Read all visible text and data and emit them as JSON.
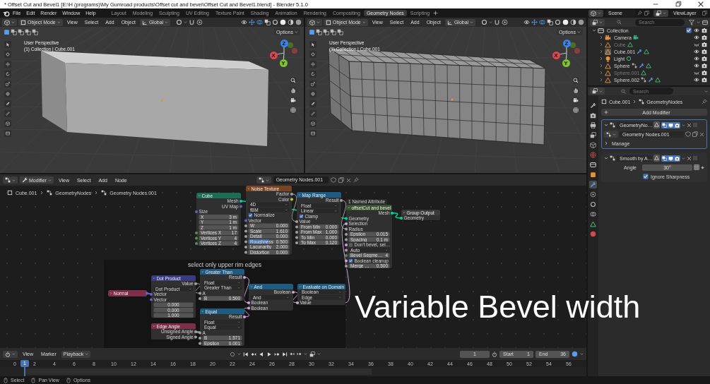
{
  "window": {
    "title": "* Offset Cut and Bevel1 [E:\\H (programs)\\My Gumroad products\\Offset cut and bevel\\Offset Cut and Bevel1.blend] - Blender 5.1.0"
  },
  "menus": [
    "File",
    "Edit",
    "Render",
    "Window",
    "Help"
  ],
  "workspaces": [
    {
      "label": "Layout",
      "selected": false
    },
    {
      "label": "Modeling",
      "selected": false
    },
    {
      "label": "Sculpting",
      "selected": false
    },
    {
      "label": "UV Editing",
      "selected": false
    },
    {
      "label": "Texture Paint",
      "selected": false
    },
    {
      "label": "Shading",
      "selected": false
    },
    {
      "label": "Animation",
      "selected": false
    },
    {
      "label": "Rendering",
      "selected": false
    },
    {
      "label": "Compositing",
      "selected": false
    },
    {
      "label": "Geometry Nodes",
      "selected": true
    },
    {
      "label": "Scripting",
      "selected": false
    }
  ],
  "scene": "Scene",
  "view_layer": "ViewLayer",
  "viewports": [
    {
      "mode": "Object Mode",
      "menus": [
        "View",
        "Select",
        "Add",
        "Object"
      ],
      "orientation": "Global",
      "options": "Options",
      "perspective": "User Perspective",
      "context": "(1) Collection | Cube.001",
      "axes": [
        "X",
        "Y",
        "Z"
      ],
      "kind": "solid"
    },
    {
      "mode": "Object Mode",
      "menus": [
        "View",
        "Select",
        "Add",
        "Object"
      ],
      "orientation": "Global",
      "options": "Options",
      "perspective": "User Perspective",
      "context": "(1) Collection | Cube.001",
      "axes": [
        "X",
        "Y",
        "Z"
      ],
      "kind": "wireframe"
    }
  ],
  "outliner": {
    "search_placeholder": "Search",
    "tree": [
      {
        "label": "Collection",
        "kind": "collection",
        "expanded": true,
        "checked": true,
        "children": [
          {
            "label": "Camera",
            "kind": "camera",
            "has_geometry_nodes": false,
            "has_modifiers": false,
            "hidden": false,
            "selected": false
          },
          {
            "label": "Cube",
            "kind": "mesh",
            "has_geometry_nodes": false,
            "has_modifiers": false,
            "hidden": true,
            "selected": false
          },
          {
            "label": "Cube.001",
            "kind": "mesh",
            "has_geometry_nodes": false,
            "has_modifiers": true,
            "hidden": false,
            "selected": true
          },
          {
            "label": "Light",
            "kind": "light",
            "has_geometry_nodes": false,
            "has_modifiers": false,
            "hidden": false,
            "selected": false
          },
          {
            "label": "Sphere",
            "kind": "mesh",
            "has_geometry_nodes": true,
            "has_modifiers": true,
            "hidden": false,
            "selected": false
          },
          {
            "label": "Sphere.001",
            "kind": "mesh",
            "has_geometry_nodes": false,
            "has_modifiers": false,
            "hidden": true,
            "selected": false
          },
          {
            "label": "Sphere.002",
            "kind": "mesh",
            "has_geometry_nodes": true,
            "has_modifiers": true,
            "hidden": false,
            "selected": false
          }
        ]
      }
    ]
  },
  "properties": {
    "search_placeholder": "Search",
    "tabs": [
      {
        "kind": "tool",
        "selected": false
      },
      {
        "kind": "render",
        "selected": false
      },
      {
        "kind": "output",
        "selected": false
      },
      {
        "kind": "view_layer",
        "selected": false
      },
      {
        "kind": "scene",
        "selected": false
      },
      {
        "kind": "world",
        "selected": false
      },
      {
        "kind": "collection",
        "selected": false
      },
      {
        "kind": "object",
        "selected": false
      },
      {
        "kind": "modifiers",
        "selected": true
      },
      {
        "kind": "particles",
        "selected": false
      },
      {
        "kind": "physics",
        "selected": false
      },
      {
        "kind": "constraints",
        "selected": false
      },
      {
        "kind": "data",
        "selected": false
      },
      {
        "kind": "material",
        "selected": false
      }
    ],
    "breadcrumb": [
      "Cube.001",
      "GeometryNodes"
    ],
    "add_modifier": "Add Modifier",
    "modifiers": [
      {
        "kind": "nodes",
        "name": "GeometryNo…",
        "expanded": true,
        "active": true,
        "node_group": "Geometry Nodes.001",
        "section": "Manage",
        "section_expanded": false
      },
      {
        "kind": "smooth",
        "name": "Smooth by A…",
        "expanded": true,
        "active": false,
        "field_label": "Angle",
        "field_value": "30°",
        "option": "Ignore Sharpness",
        "option_checked": true
      }
    ]
  },
  "node_editor": {
    "context": "Modifier",
    "menus": [
      "View",
      "Select",
      "Add",
      "Node"
    ],
    "node_group": "Geometry Nodes.001",
    "breadcrumb": [
      "Cube.001",
      "GeometryNodes",
      "Geometry Nodes.001"
    ],
    "frame_label": "select only upper rim edges",
    "nodes": [
      {
        "title": "Cube",
        "color": "#1e6b56",
        "collapsed": false,
        "rows": [
          {
            "kind": "out",
            "label": "Mesh",
            "color": "#00d6a3"
          },
          {
            "kind": "out",
            "label": "UV Map",
            "color": "#6363c7"
          },
          {
            "kind": "in",
            "label": "Size",
            "color": "#6363c7"
          },
          {
            "kind": "value",
            "label": "X",
            "value": "3 m"
          },
          {
            "kind": "value",
            "label": "Y",
            "value": "1 m"
          },
          {
            "kind": "value",
            "label": "Z",
            "value": "1 m"
          },
          {
            "kind": "value",
            "label": "Vertices X",
            "value": "17",
            "color": "#598c5c"
          },
          {
            "kind": "value",
            "label": "Vertices Y",
            "value": "4",
            "color": "#598c5c"
          },
          {
            "kind": "value",
            "label": "Vertices Z",
            "value": "4",
            "color": "#598c5c"
          }
        ]
      },
      {
        "title": "Noise Texture",
        "color": "#7a4322",
        "collapsed": false,
        "rows": [
          {
            "kind": "out",
            "label": "Factor",
            "color": "#a1a1a1"
          },
          {
            "kind": "out",
            "label": "Color",
            "color": "#c7c729"
          },
          {
            "kind": "menu",
            "value": "4D"
          },
          {
            "kind": "menu",
            "value": "fBM"
          },
          {
            "kind": "check",
            "label": "Normalize",
            "checked": true
          },
          {
            "kind": "in",
            "label": "Vector",
            "color": "#6363c7"
          },
          {
            "kind": "value",
            "label": "W",
            "value": "0.000",
            "color": "#a1a1a1"
          },
          {
            "kind": "value",
            "label": "Scale",
            "value": "1.610",
            "color": "#a1a1a1"
          },
          {
            "kind": "value",
            "label": "Detail",
            "value": "0.000",
            "color": "#a1a1a1"
          },
          {
            "kind": "slider",
            "label": "Roughness",
            "value": "0.500",
            "level": 0.5,
            "color": "#a1a1a1"
          },
          {
            "kind": "value",
            "label": "Lacunarity",
            "value": "2.000",
            "color": "#a1a1a1"
          },
          {
            "kind": "value",
            "label": "Distortion",
            "value": "0.000",
            "color": "#a1a1a1"
          }
        ]
      },
      {
        "title": "Map Range",
        "color": "#1f5a80",
        "collapsed": false,
        "rows": [
          {
            "kind": "out",
            "label": "Result",
            "color": "#a1a1a1"
          },
          {
            "kind": "menu",
            "value": "Float"
          },
          {
            "kind": "menu",
            "value": "Linear"
          },
          {
            "kind": "check",
            "label": "Clamp",
            "checked": true
          },
          {
            "kind": "in",
            "label": "Value",
            "color": "#a1a1a1"
          },
          {
            "kind": "value",
            "label": "From Min",
            "value": "0.000",
            "color": "#a1a1a1"
          },
          {
            "kind": "value",
            "label": "From Max",
            "value": "1.000",
            "color": "#a1a1a1"
          },
          {
            "kind": "value",
            "label": "To Min",
            "value": "0.000",
            "color": "#a1a1a1"
          },
          {
            "kind": "value",
            "label": "To Max",
            "value": "0.120",
            "color": "#a1a1a1"
          }
        ]
      },
      {
        "title": "offsetCut and bevel",
        "color": "#3b5230",
        "collapsed": false,
        "badge": "1 Named Attribute",
        "rows": [
          {
            "kind": "out",
            "label": "Mesh",
            "color": "#00d6a3"
          },
          {
            "kind": "in",
            "label": "Geometry",
            "color": "#00d6a3"
          },
          {
            "kind": "in",
            "label": "Selection",
            "color": "#cca6d6"
          },
          {
            "kind": "in",
            "label": "Radius",
            "color": "#a1a1a1"
          },
          {
            "kind": "value",
            "label": "Epsilon",
            "value": "0.015",
            "color": "#a1a1a1"
          },
          {
            "kind": "value",
            "label": "Spacing",
            "value": "0.1 m",
            "color": "#a1a1a1"
          },
          {
            "kind": "check",
            "label": "Don't bevel, sel…",
            "checked": false,
            "color": "#cca6d6"
          },
          {
            "kind": "menu",
            "value": "Auto",
            "color": "#a1a1a1"
          },
          {
            "kind": "value",
            "label": "Bevel Segme…",
            "value": "4",
            "color": "#598c5c"
          },
          {
            "kind": "check",
            "label": "Boolean cleanup",
            "checked": true,
            "color": "#cca6d6"
          },
          {
            "kind": "value",
            "label": "Merge …",
            "value": "0.500",
            "color": "#a1a1a1"
          }
        ]
      },
      {
        "title": "Group Output",
        "color": "#3a3a3a",
        "collapsed": false,
        "rows": [
          {
            "kind": "in",
            "label": "Geometry",
            "color": "#00d6a3"
          }
        ]
      },
      {
        "title": "Normal",
        "color": "#7d2e48",
        "collapsed": true,
        "rows": [
          {
            "kind": "out",
            "color": "#6363c7"
          }
        ]
      },
      {
        "title": "Dot Product",
        "color": "#3a3a80",
        "collapsed": false,
        "rows": [
          {
            "kind": "out",
            "label": "Value",
            "color": "#a1a1a1"
          },
          {
            "kind": "menu",
            "value": "Dot Product"
          },
          {
            "kind": "in",
            "label": "Vector",
            "color": "#6363c7"
          },
          {
            "kind": "in",
            "label": "Vector",
            "color": "#6363c7"
          },
          {
            "kind": "value",
            "value": "0.000"
          },
          {
            "kind": "value",
            "value": "0.000"
          },
          {
            "kind": "value",
            "value": "1.000"
          }
        ]
      },
      {
        "title": "Edge Angle",
        "color": "#7d2e48",
        "collapsed": false,
        "rows": [
          {
            "kind": "out",
            "label": "Unsigned Angle",
            "color": "#a1a1a1"
          },
          {
            "kind": "out",
            "label": "Signed Angle",
            "color": "#a1a1a1"
          }
        ]
      },
      {
        "title": "Greater Than",
        "color": "#1f5a80",
        "collapsed": false,
        "rows": [
          {
            "kind": "out",
            "label": "Result",
            "color": "#cca6d6"
          },
          {
            "kind": "menu",
            "value": "Float"
          },
          {
            "kind": "menu",
            "value": "Greater Than"
          },
          {
            "kind": "in",
            "label": "A",
            "color": "#a1a1a1"
          },
          {
            "kind": "value",
            "label": "B",
            "value": "0.500",
            "color": "#a1a1a1"
          }
        ]
      },
      {
        "title": "Equal",
        "color": "#1f5a80",
        "collapsed": false,
        "rows": [
          {
            "kind": "out",
            "label": "Result",
            "color": "#cca6d6"
          },
          {
            "kind": "menu",
            "value": "Float"
          },
          {
            "kind": "menu",
            "value": "Equal"
          },
          {
            "kind": "in",
            "label": "A",
            "color": "#a1a1a1"
          },
          {
            "kind": "value",
            "label": "B",
            "value": "1.571",
            "color": "#a1a1a1"
          },
          {
            "kind": "value",
            "label": "Epsilon",
            "value": "0.001",
            "color": "#a1a1a1"
          }
        ]
      },
      {
        "title": "And",
        "color": "#1f5a80",
        "collapsed": false,
        "rows": [
          {
            "kind": "out",
            "label": "Boolean",
            "color": "#cca6d6"
          },
          {
            "kind": "menu",
            "value": "And"
          },
          {
            "kind": "in",
            "label": "Boolean",
            "color": "#cca6d6"
          },
          {
            "kind": "in",
            "label": "Boolean",
            "color": "#cca6d6"
          }
        ]
      },
      {
        "title": "Evaluate on Domain",
        "color": "#1f5a80",
        "collapsed": false,
        "rows": [
          {
            "kind": "menu",
            "value": "Boolean"
          },
          {
            "kind": "menu",
            "value": "Edge"
          },
          {
            "kind": "in",
            "label": "Value",
            "color": "#cca6d6"
          }
        ]
      }
    ]
  },
  "caption": "Variable Bevel width",
  "timeline": {
    "menus": [
      "View",
      "Marker"
    ],
    "playback": "Playback",
    "current_frame": "1",
    "start_label": "Start",
    "start": "1",
    "end_label": "End",
    "end": "36",
    "playhead": "1",
    "ruler": [
      "0",
      "2",
      "4",
      "6",
      "8",
      "10",
      "12",
      "14",
      "16",
      "18",
      "20",
      "22",
      "24",
      "26",
      "28",
      "30",
      "32",
      "34",
      "36",
      "38",
      "40",
      "42",
      "44",
      "46",
      "48",
      "50",
      "52",
      "54",
      "56"
    ]
  },
  "status_bar": [
    "Select",
    "Pan View",
    "Options"
  ]
}
